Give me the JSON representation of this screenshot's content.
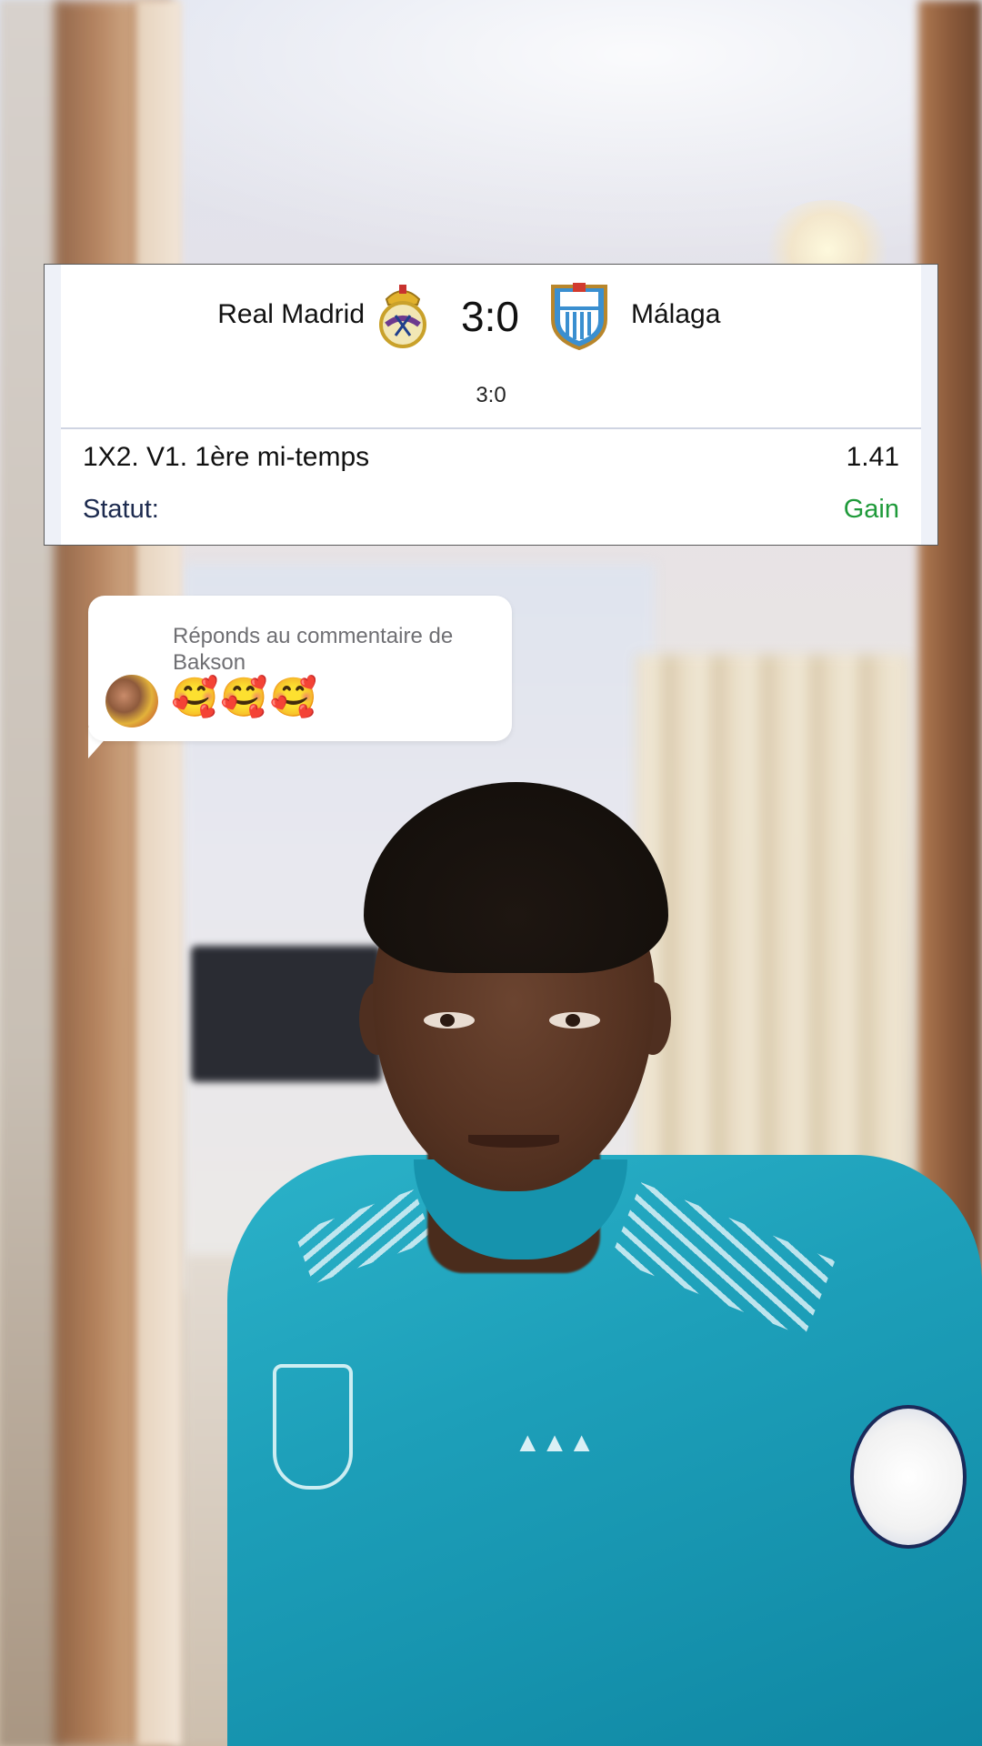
{
  "bet_slip": {
    "home_team": "Real Madrid",
    "away_team": "Málaga",
    "score": "3:0",
    "halftime_score": "3:0",
    "bet_description": "1X2. V1. 1ère mi-temps",
    "odds": "1.41",
    "status_label": "Statut:",
    "status_value": "Gain",
    "status_color": "#1f9a3a",
    "home_crest_icon": "real-madrid-crest-icon",
    "away_crest_icon": "malaga-crest-icon"
  },
  "comment_reply": {
    "label": "Réponds au commentaire de Bakson",
    "emojis": "🥰🥰🥰",
    "avatar_icon": "user-avatar"
  }
}
